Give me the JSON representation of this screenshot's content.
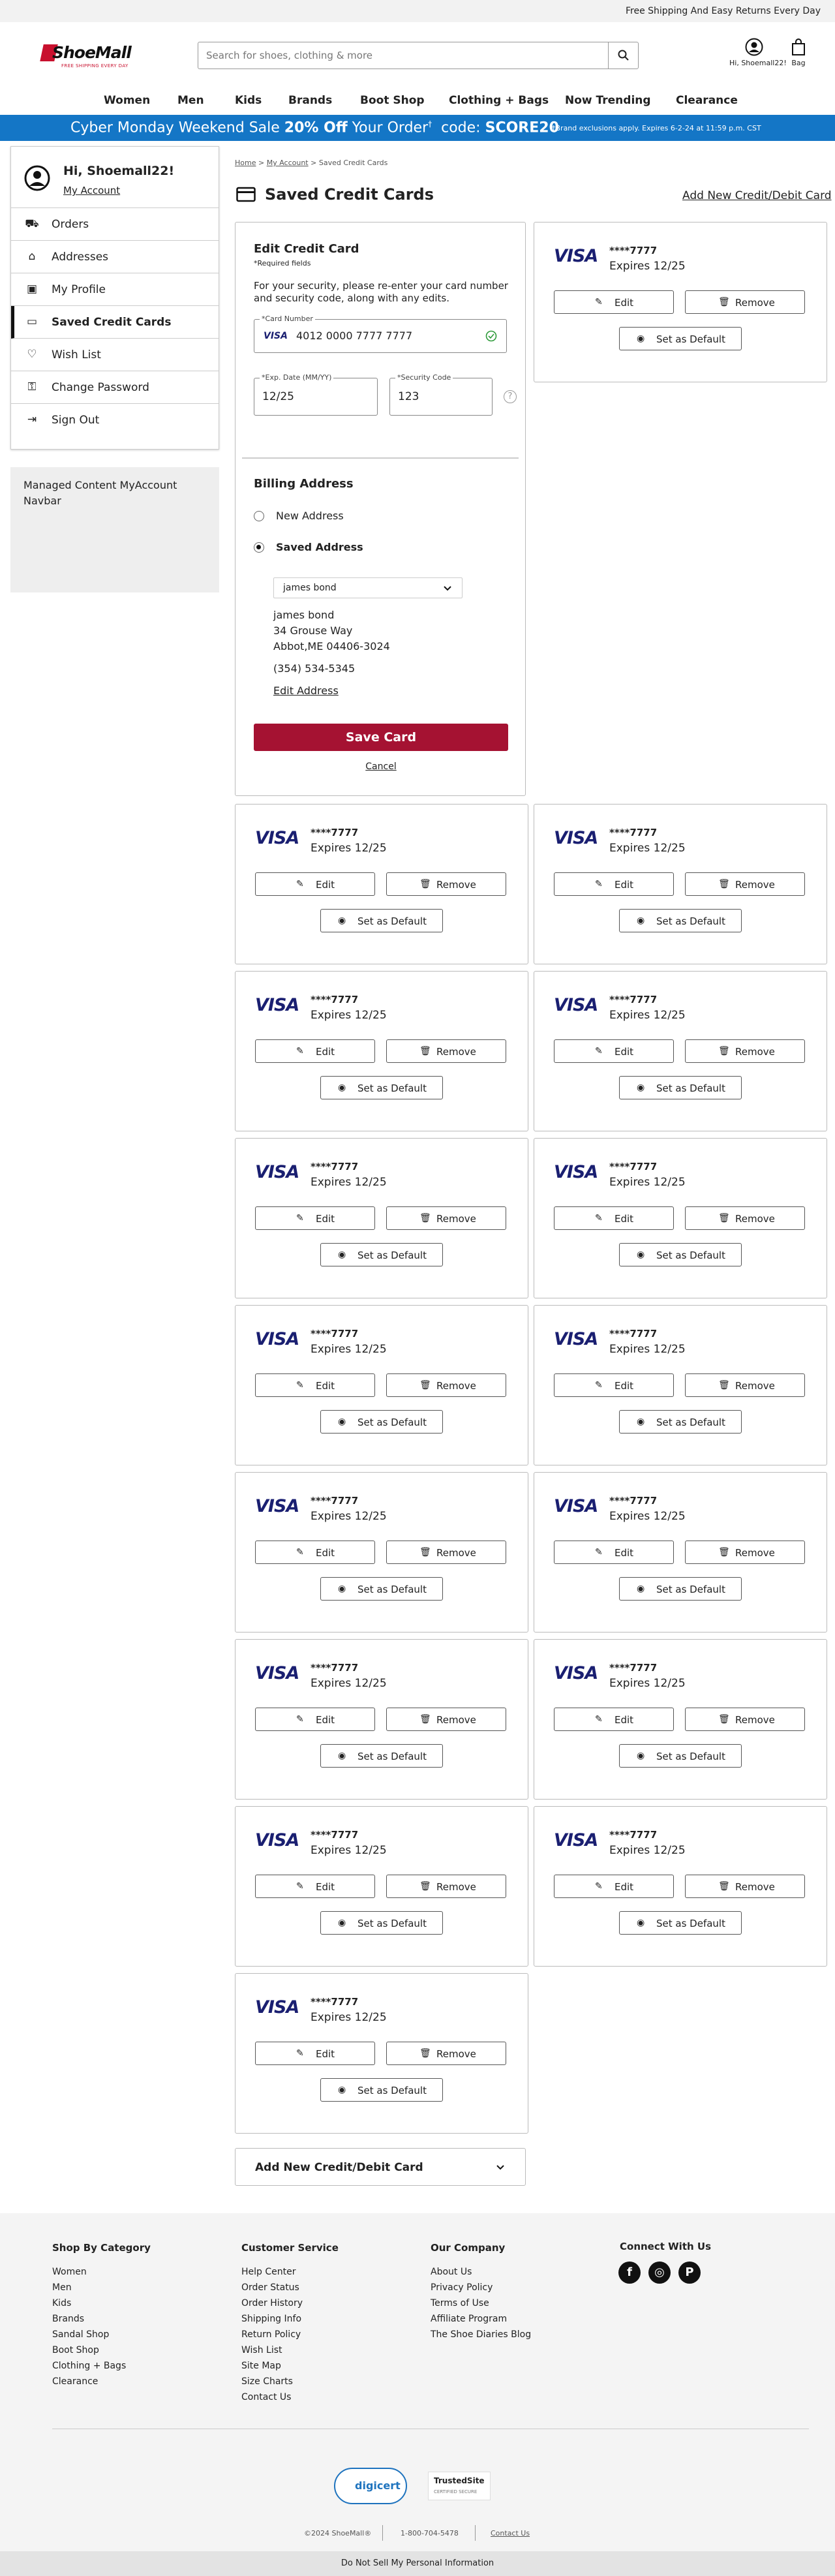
{
  "topbar": {
    "message": "Free Shipping And Easy Returns Every Day"
  },
  "header": {
    "logo_text": "ShoeMall",
    "logo_tagline": "FREE SHIPPING EVERY DAY",
    "search_placeholder": "Search for shoes, clothing & more",
    "account_label": "Hi, Shoemall22!",
    "bag_label": "Bag"
  },
  "nav": {
    "items": [
      "Women",
      "Men",
      "Kids",
      "Brands",
      "Boot Shop",
      "Clothing + Bags",
      "Now Trending",
      "Clearance"
    ]
  },
  "promo": {
    "text_a": "Cyber Monday Weekend Sale",
    "text_b": "20% Off",
    "text_c": "Your Order",
    "sup": "†",
    "text_d": "code:",
    "code": "SCORE20",
    "fine": "†Brand exclusions apply. Expires 6-2-24 at 11:59 p.m. CST"
  },
  "sidebar": {
    "greeting": "Hi, Shoemall22!",
    "my_account": "My Account",
    "items": [
      {
        "label": "Orders",
        "icon": "truck-icon"
      },
      {
        "label": "Addresses",
        "icon": "building-icon"
      },
      {
        "label": "My Profile",
        "icon": "id-card-icon"
      },
      {
        "label": "Saved Credit Cards",
        "icon": "credit-card-icon"
      },
      {
        "label": "Wish List",
        "icon": "heart-icon"
      },
      {
        "label": "Change Password",
        "icon": "key-icon"
      },
      {
        "label": "Sign Out",
        "icon": "sign-out-icon"
      }
    ],
    "managed_content": "Managed Content MyAccount Navbar"
  },
  "breadcrumb": {
    "home": "Home",
    "my_account": "My Account",
    "current": "Saved Credit Cards",
    "sep": ">"
  },
  "page": {
    "title": "Saved Credit Cards",
    "add_link": "Add New Credit/Debit Card"
  },
  "edit_form": {
    "title": "Edit Credit Card",
    "required": "*Required fields",
    "security_note": "For your security, please re-enter your card number and security code, along with any edits.",
    "card_number_label": "*Card Number",
    "card_number": "4012 0000 7777 7777",
    "exp_label": "*Exp. Date (MM/YY)",
    "exp_value": "12/25",
    "sec_label": "*Security Code",
    "sec_value": "123",
    "billing_title": "Billing Address",
    "new_address": "New Address",
    "saved_address": "Saved Address",
    "saved_select": "james bond",
    "address_lines": [
      "james bond",
      "34 Grouse Way",
      "Abbot,ME 04406-3024",
      "(354) 534-5345"
    ],
    "edit_address": "Edit Address",
    "save_card": "Save Card",
    "cancel": "Cancel"
  },
  "card_common": {
    "brand": "VISA",
    "masked": "****7777",
    "expires": "Expires 12/25",
    "edit": "Edit",
    "remove": "Remove",
    "set_default": "Set as Default"
  },
  "add_card_dropdown": {
    "label": "Add New Credit/Debit Card"
  },
  "footer": {
    "columns": [
      {
        "title": "Shop By Category",
        "links": [
          "Women",
          "Men",
          "Kids",
          "Brands",
          "Sandal Shop",
          "Boot Shop",
          "Clothing + Bags",
          "Clearance"
        ]
      },
      {
        "title": "Customer Service",
        "links": [
          "Help Center",
          "Order Status",
          "Order History",
          "Shipping Info",
          "Return Policy",
          "Wish List",
          "Site Map",
          "Size Charts",
          "Contact Us"
        ]
      },
      {
        "title": "Our Company",
        "links": [
          "About Us",
          "Privacy Policy",
          "Terms of Use",
          "Affiliate Program",
          "The Shoe Diaries Blog"
        ]
      }
    ],
    "connect_title": "Connect With Us",
    "social": [
      {
        "icon": "facebook-icon",
        "glyph": "f"
      },
      {
        "icon": "instagram-icon",
        "glyph": "◎"
      },
      {
        "icon": "pinterest-icon",
        "glyph": "P"
      }
    ],
    "digicert": "digicert",
    "trustedsite": "TrustedSite",
    "trusted_sub": "CERTIFIED SECURE",
    "copyright": "©2024 ShoeMall®",
    "phone": "1-800-704-5478",
    "contact": "Contact Us",
    "do_not_sell": "Do Not Sell My Personal Information"
  },
  "colors": {
    "brand_red": "#c8102e",
    "promo_blue": "#1476c6",
    "save_button": "#a51232",
    "visa_blue": "#1a1f71"
  }
}
